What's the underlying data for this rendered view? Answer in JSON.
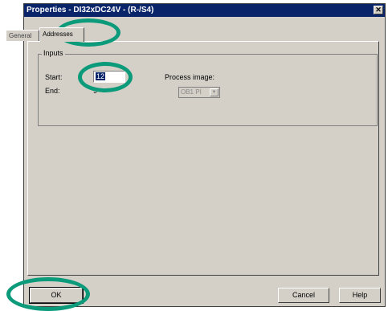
{
  "window": {
    "title": "Properties - DI32xDC24V - (R-/S4)"
  },
  "tabs": [
    {
      "label": "General"
    },
    {
      "label": "Addresses"
    }
  ],
  "inputs_group": {
    "label": "Inputs",
    "start_label": "Start:",
    "start_value": "12",
    "end_label": "End:",
    "end_value": "9",
    "process_image_label": "Process image:",
    "process_image_value": "OB1 PI"
  },
  "buttons": {
    "ok": "OK",
    "cancel": "Cancel",
    "help": "Help"
  },
  "colors": {
    "titlebar": "#0a246a",
    "dialog_bg": "#d4d0c8",
    "highlight_ring": "#0b9a7a"
  }
}
